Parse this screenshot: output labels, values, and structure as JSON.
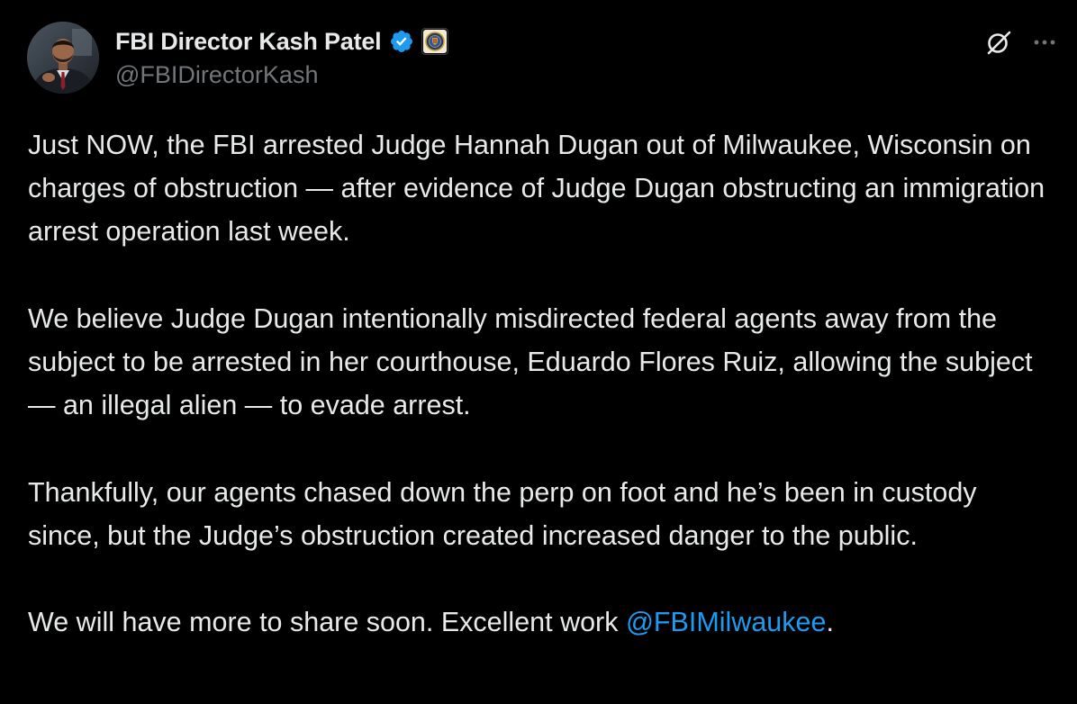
{
  "post": {
    "author": {
      "display_name": "FBI Director Kash Patel",
      "handle": "@FBIDirectorKash",
      "verified": true,
      "verified_icon": "verified-badge-icon",
      "affiliation_badge_icon": "fbi-seal-icon",
      "avatar_icon": "avatar"
    },
    "actions": {
      "grok_icon": "grok-icon",
      "more_icon": "more-icon"
    },
    "paragraphs": [
      "Just NOW, the FBI arrested Judge Hannah Dugan out of Milwaukee, Wisconsin on charges of obstruction — after evidence of Judge Dugan obstructing an immigration arrest operation last week.",
      "We believe Judge Dugan intentionally misdirected federal agents away from the subject to be arrested in her courthouse, Eduardo Flores Ruiz, allowing the subject — an illegal alien — to evade arrest.",
      "Thankfully, our agents chased down the perp on foot and he’s been in custody since, but the Judge’s obstruction created increased danger to the public."
    ],
    "last_paragraph": {
      "text_before": "We will have more to share soon. Excellent work ",
      "mention": "@FBIMilwaukee",
      "text_after": "."
    }
  },
  "colors": {
    "background": "#000000",
    "text_primary": "#e7e9ea",
    "text_secondary": "#71767b",
    "link": "#1d9bf0",
    "verified_blue": "#1d9bf0"
  }
}
